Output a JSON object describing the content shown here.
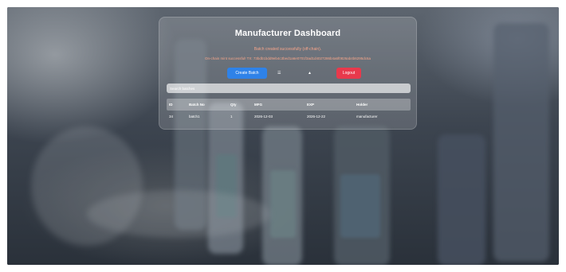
{
  "dashboard": {
    "title": "Manufacturer Dashboard",
    "message_created": "Batch created successfully (off-chain).",
    "message_onchain": "On-chain mint successful! TX: 73bdb1bdd9eb4c3bed1a6e0701f3ad1d4027286b4a6f0826ab4b6295dc6a",
    "create_button": "Create Batch",
    "toggle_icon": "☰",
    "theme_icon": "▲",
    "logout_button": "Logout",
    "search_placeholder": "Search batches"
  },
  "table": {
    "headers": [
      "ID",
      "Batch No",
      "Qty",
      "MFG",
      "EXP",
      "Holder"
    ],
    "rows": [
      [
        "34",
        "batch1",
        "1",
        "2026-12-03",
        "2026-12-22",
        "manufacturer"
      ]
    ]
  },
  "colors": {
    "accent_blue": "#2f82e8",
    "danger_red": "#e8394c",
    "message_text": "#f7a58a"
  }
}
